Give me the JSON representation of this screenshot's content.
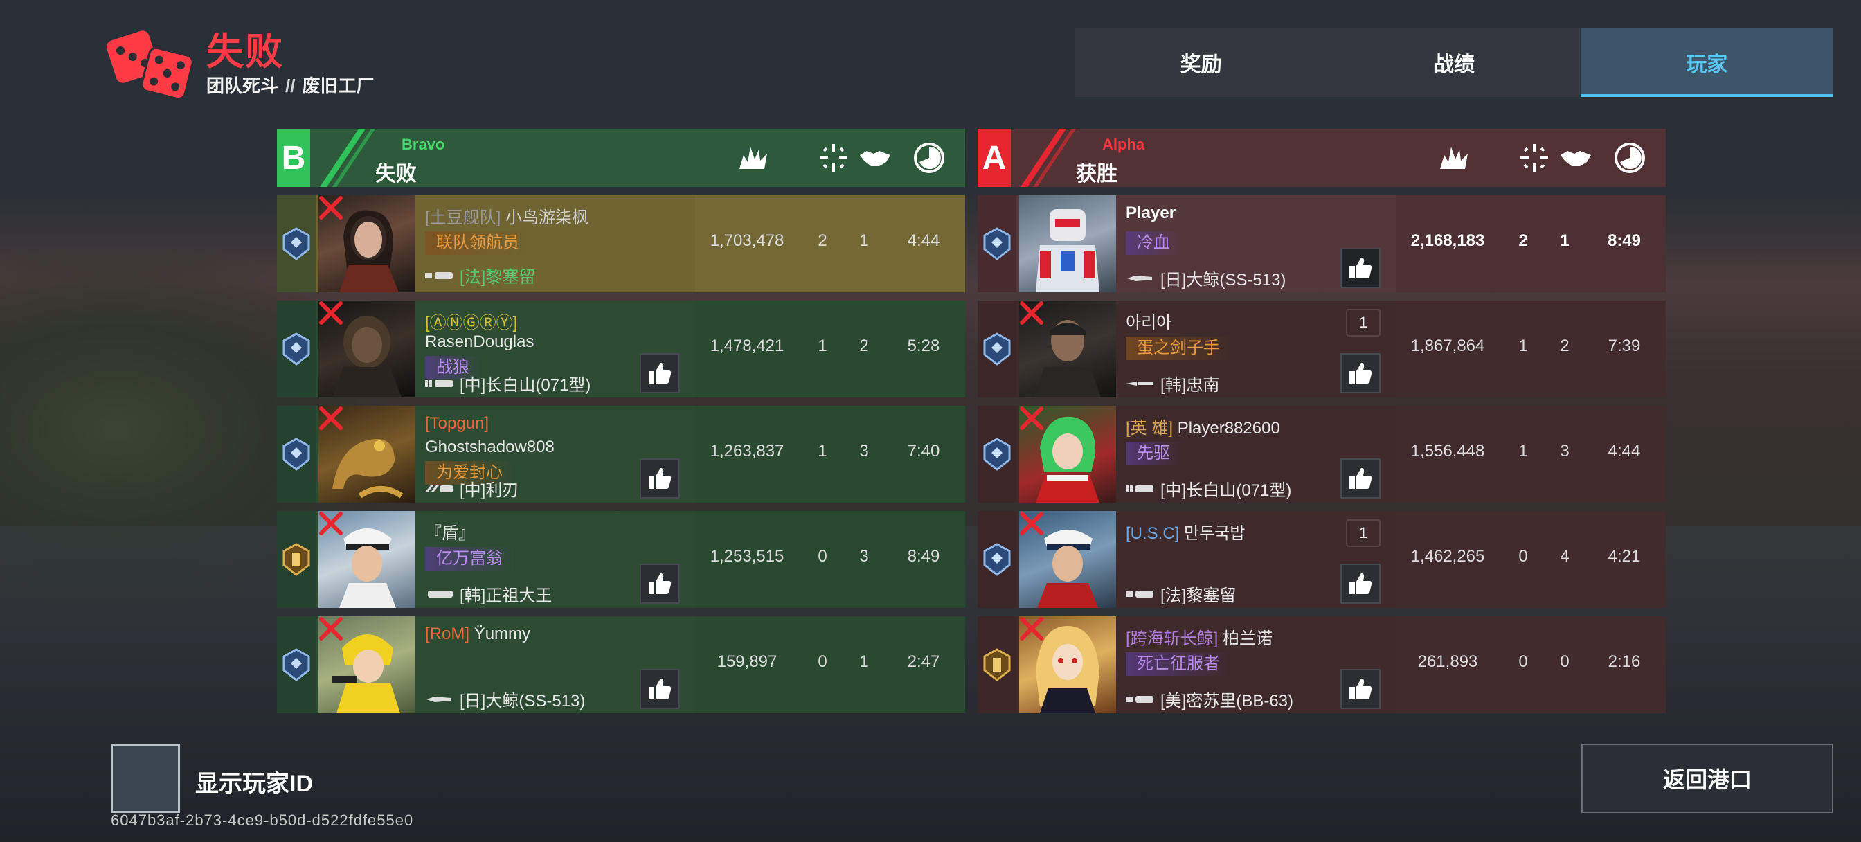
{
  "header": {
    "result": "失败",
    "mode": "团队死斗",
    "separator": "//",
    "map": "废旧工厂"
  },
  "tabs": [
    {
      "label": "奖励",
      "active": false
    },
    {
      "label": "战绩",
      "active": false
    },
    {
      "label": "玩家",
      "active": true
    }
  ],
  "team_b": {
    "letter": "B",
    "name": "Bravo",
    "status": "失败",
    "color": "#2fc25a",
    "players": [
      {
        "clan": "[土豆舰队]",
        "name": "小鸟游柒枫",
        "title": "联队领航员",
        "ship": "[法]黎塞留",
        "score": "1,703,478",
        "kills": "2",
        "assists": "1",
        "time": "4:44"
      },
      {
        "clan": "[ⒶⓃⒼⓇⓎ]",
        "name": "RasenDouglas",
        "title": "战狼",
        "ship": "[中]长白山(071型)",
        "score": "1,478,421",
        "kills": "1",
        "assists": "2",
        "time": "5:28"
      },
      {
        "clan": "[Topgun]",
        "name": "Ghostshadow808",
        "title": "为爱封心",
        "ship": "[中]利刃",
        "score": "1,263,837",
        "kills": "1",
        "assists": "3",
        "time": "7:40"
      },
      {
        "clan": "",
        "name": "『盾』",
        "title": "亿万富翁",
        "ship": "[韩]正祖大王",
        "score": "1,253,515",
        "kills": "0",
        "assists": "3",
        "time": "8:49"
      },
      {
        "clan": "[RoM]",
        "name": "Ÿummy",
        "title": "",
        "ship": "[日]大鲸(SS-513)",
        "score": "159,897",
        "kills": "0",
        "assists": "1",
        "time": "2:47"
      }
    ]
  },
  "team_a": {
    "letter": "A",
    "name": "Alpha",
    "status": "获胜",
    "color": "#e8262f",
    "players": [
      {
        "clan": "",
        "name": "Player",
        "title": "冷血",
        "ship": "[日]大鲸(SS-513)",
        "score": "2,168,183",
        "kills": "2",
        "assists": "1",
        "time": "8:49",
        "likes": ""
      },
      {
        "clan": "",
        "name": "아리아",
        "title": "蛋之剑子手",
        "ship": "[韩]忠南",
        "score": "1,867,864",
        "kills": "1",
        "assists": "2",
        "time": "7:39",
        "likes": "1"
      },
      {
        "clan": "[英 雄]",
        "name": "Player882600",
        "title": "先驱",
        "ship": "[中]长白山(071型)",
        "score": "1,556,448",
        "kills": "1",
        "assists": "3",
        "time": "4:44",
        "likes": ""
      },
      {
        "clan": "[U.S.C]",
        "name": "만두국밥",
        "title": "",
        "ship": "[法]黎塞留",
        "score": "1,462,265",
        "kills": "0",
        "assists": "4",
        "time": "4:21",
        "likes": "1"
      },
      {
        "clan": "[跨海斩长鲸]",
        "name": "柏兰诺",
        "title": "死亡征服者",
        "ship": "[美]密苏里(BB-63)",
        "score": "261,893",
        "kills": "0",
        "assists": "0",
        "time": "2:16",
        "likes": ""
      }
    ]
  },
  "footer": {
    "show_id_label": "显示玩家ID",
    "match_id": "6047b3af-2b73-4ce9-b50d-d522fdfe55e0",
    "return_label": "返回港口"
  },
  "icons": {
    "logo": "dice-icon",
    "score": "explosion-icon",
    "kills": "crosshair-icon",
    "assists": "handshake-icon",
    "time": "clock-icon",
    "like": "thumbs-up-icon",
    "dead": "cross-icon"
  },
  "colors": {
    "defeat_red": "#ff3b45",
    "active_tab": "#56c6f2",
    "bravo_green": "#2fc25a",
    "alpha_red": "#e8262f"
  }
}
